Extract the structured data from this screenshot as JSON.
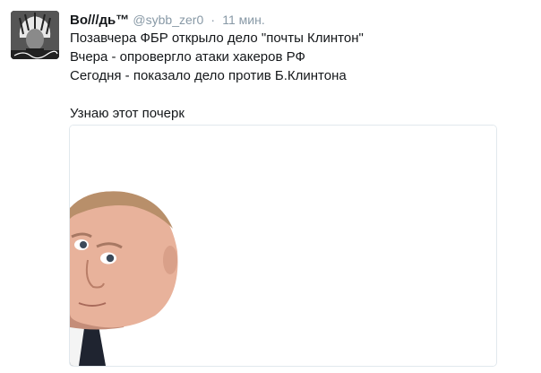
{
  "tweet": {
    "name": "Во///дь™",
    "handle": "@sybb_zer0",
    "separator": "·",
    "time": "11 мин.",
    "lines": [
      "Позавчера ФБР открыло дело \"почты Клинтон\"",
      "Вчера - опровергло атаки хакеров РФ",
      "Сегодня - показало дело против Б.Клинтона",
      "",
      "Узнаю этот почерк"
    ]
  },
  "colors": {
    "text": "#14171a",
    "meta": "#8899a6",
    "border": "#e1e8ed"
  },
  "icons": {
    "avatar": "avatar-image",
    "media": "peeking-man-photo"
  }
}
